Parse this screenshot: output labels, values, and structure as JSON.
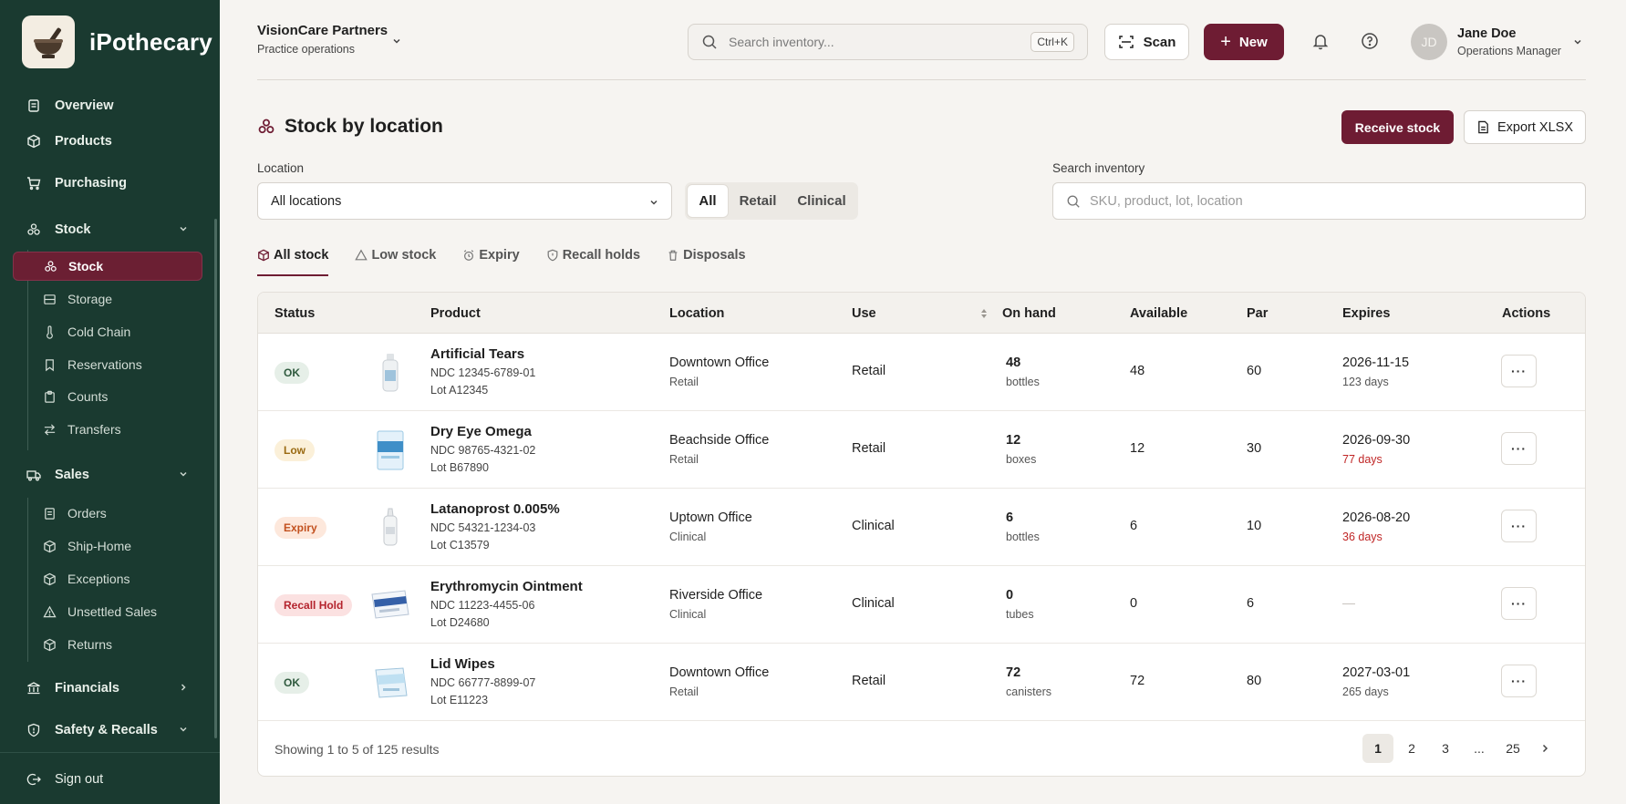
{
  "app": {
    "name": "iPothecary"
  },
  "sidebar": {
    "overview": "Overview",
    "products": "Products",
    "purchasing": "Purchasing",
    "stock": {
      "label": "Stock",
      "items": [
        "Stock",
        "Storage",
        "Cold Chain",
        "Reservations",
        "Counts",
        "Transfers"
      ]
    },
    "sales": {
      "label": "Sales",
      "items": [
        "Orders",
        "Ship-Home",
        "Exceptions",
        "Unsettled Sales",
        "Returns"
      ]
    },
    "financials": "Financials",
    "safety": "Safety & Recalls",
    "sign_out": "Sign out"
  },
  "header": {
    "org_name": "VisionCare Partners",
    "org_sub": "Practice operations",
    "search_placeholder": "Search inventory...",
    "shortcut": "Ctrl+K",
    "scan": "Scan",
    "new": "New",
    "user_initials": "JD",
    "user_name": "Jane Doe",
    "user_role": "Operations Manager"
  },
  "page": {
    "title": "Stock by location",
    "receive": "Receive stock",
    "export": "Export XLSX",
    "location_label": "Location",
    "location_value": "All locations",
    "segments": [
      "All",
      "Retail",
      "Clinical"
    ],
    "segment_selected": "All",
    "search_label": "Search inventory",
    "search_placeholder": "SKU, product, lot, location",
    "tabs": [
      "All stock",
      "Low stock",
      "Expiry",
      "Recall holds",
      "Disposals"
    ],
    "active_tab": "All stock"
  },
  "table": {
    "columns": [
      "Status",
      "Product",
      "Location",
      "Use",
      "On hand",
      "Available",
      "Par",
      "Expires",
      "Actions"
    ],
    "rows": [
      {
        "status": "OK",
        "product": "Artificial Tears",
        "ndc": "NDC 12345-6789-01",
        "lot": "Lot A12345",
        "location": "Downtown Office",
        "loc_type": "Retail",
        "use": "Retail",
        "on_hand": "48",
        "unit": "bottles",
        "available": "48",
        "par": "60",
        "expires": "2026-11-15",
        "days": "123 days"
      },
      {
        "status": "Low",
        "product": "Dry Eye Omega",
        "ndc": "NDC 98765-4321-02",
        "lot": "Lot B67890",
        "location": "Beachside Office",
        "loc_type": "Retail",
        "use": "Retail",
        "on_hand": "12",
        "unit": "boxes",
        "available": "12",
        "par": "30",
        "expires": "2026-09-30",
        "days": "77 days"
      },
      {
        "status": "Expiry",
        "product": "Latanoprost 0.005%",
        "ndc": "NDC 54321-1234-03",
        "lot": "Lot C13579",
        "location": "Uptown Office",
        "loc_type": "Clinical",
        "use": "Clinical",
        "on_hand": "6",
        "unit": "bottles",
        "available": "6",
        "par": "10",
        "expires": "2026-08-20",
        "days": "36 days"
      },
      {
        "status": "Recall Hold",
        "product": "Erythromycin Ointment",
        "ndc": "NDC 11223-4455-06",
        "lot": "Lot D24680",
        "location": "Riverside Office",
        "loc_type": "Clinical",
        "use": "Clinical",
        "on_hand": "0",
        "unit": "tubes",
        "available": "0",
        "par": "6",
        "expires": "—",
        "days": ""
      },
      {
        "status": "OK",
        "product": "Lid Wipes",
        "ndc": "NDC 66777-8899-07",
        "lot": "Lot E11223",
        "location": "Downtown Office",
        "loc_type": "Retail",
        "use": "Retail",
        "on_hand": "72",
        "unit": "canisters",
        "available": "72",
        "par": "80",
        "expires": "2027-03-01",
        "days": "265 days"
      }
    ],
    "action_label": "···"
  },
  "pagination": {
    "showing": "Showing 1 to 5 of 125 results",
    "pages": [
      "1",
      "2",
      "3",
      "...",
      "25"
    ],
    "current": "1"
  },
  "colors": {
    "sidebar_bg": "#1a3a30",
    "accent": "#6e1c33",
    "ok_bg": "#e6efe8",
    "ok_fg": "#2f5a3e",
    "low_bg": "#fbf0d9",
    "low_fg": "#9a6a12",
    "expiry_bg": "#fde8dc",
    "expiry_fg": "#c2511f",
    "recall_bg": "#fbe1e1",
    "recall_fg": "#b4232d",
    "warn_text": "#c02626"
  }
}
